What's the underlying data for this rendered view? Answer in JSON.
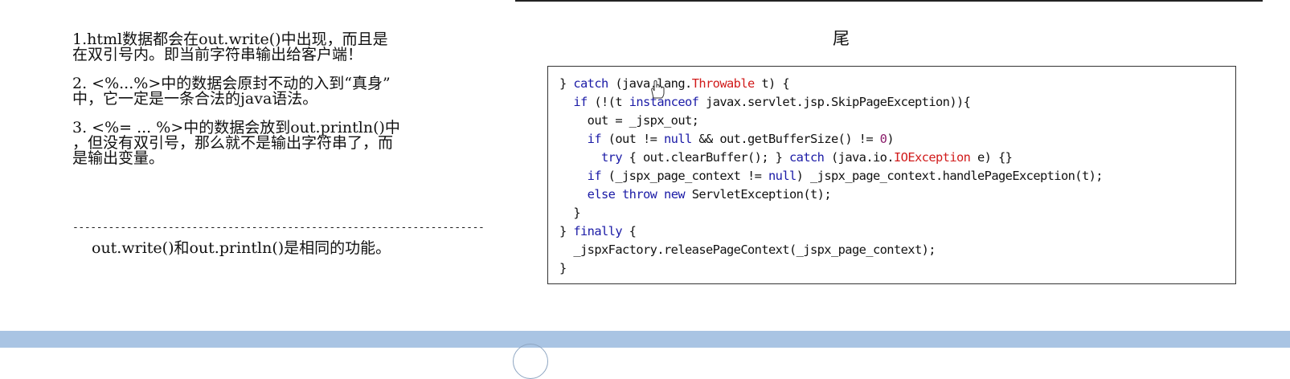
{
  "notes": {
    "item1": "1.html数据都会在out.write()中出现，而且是\n在双引号内。即当前字符串输出给客户端！",
    "item2": "2. <%...%>中的数据会原封不动的入到“真身”\n中，它一定是一条合法的java语法。",
    "item3": "3. <%= ... %>中的数据会放到out.println()中\n，但没有双引号，那么就不是输出字符串了，而\n是输出变量。",
    "divider": "---------------------------------------------------------------------------------------",
    "footer": "out.write()和out.println()是相同的功能。"
  },
  "slide": {
    "title": "尾"
  },
  "code": {
    "l1": {
      "a": "} ",
      "b": "catch",
      "c": " (java.lang.",
      "d": "Throwable",
      "e": " t) {"
    },
    "l2": {
      "a": "  ",
      "b": "if",
      "c": " (!(t ",
      "d": "instanceof",
      "e": " javax.servlet.jsp.SkipPageException)){"
    },
    "l3": {
      "a": "    out = _jspx_out;"
    },
    "l4": {
      "a": "    ",
      "b": "if",
      "c": " (out != ",
      "d": "null",
      "e": " && out.getBufferSize() != ",
      "f": "0",
      "g": ")"
    },
    "l5": {
      "a": "      ",
      "b": "try",
      "c": " { out.clearBuffer(); } ",
      "d": "catch",
      "e": " (java.io.",
      "f": "IOException",
      "g": " e) {}"
    },
    "l6": {
      "a": "    ",
      "b": "if",
      "c": " (_jspx_page_context != ",
      "d": "null",
      "e": ") _jspx_page_context.handlePageException(t);"
    },
    "l7": {
      "a": "    ",
      "b": "else",
      "c": " ",
      "d": "throw",
      "e": " ",
      "f": "new",
      "g": " ServletException(t);"
    },
    "l8": {
      "a": "  }"
    },
    "l9": {
      "a": "} ",
      "b": "finally",
      "c": " {"
    },
    "l10": {
      "a": "  _jspxFactory.releasePageContext(_jspx_page_context);"
    },
    "l11": {
      "a": "}"
    }
  },
  "icons": {
    "cursor": "hand-cursor-icon"
  },
  "colors": {
    "keyword": "#1a1aa6",
    "exception": "#d11b1b",
    "number": "#8a1c6a",
    "bottom_bar": "#a9c4e3"
  }
}
